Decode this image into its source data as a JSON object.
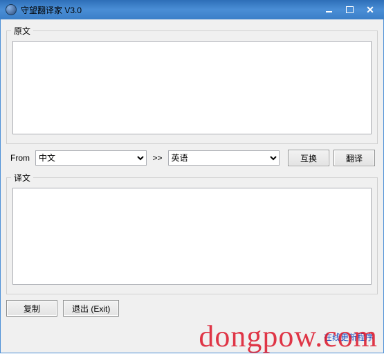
{
  "title": "守望翻译家 V3.0",
  "groups": {
    "source_label": "原文",
    "target_label": "译文"
  },
  "source_text": "",
  "target_text": "",
  "lang": {
    "from_label": "From",
    "separator": ">>",
    "from_value": "中文",
    "to_value": "英语",
    "swap_label": "互换",
    "translate_label": "翻译"
  },
  "buttons": {
    "copy": "复制",
    "exit": "退出 (Exit)"
  },
  "link": {
    "update": "在线更新程序"
  },
  "watermark": "dongpow.com"
}
